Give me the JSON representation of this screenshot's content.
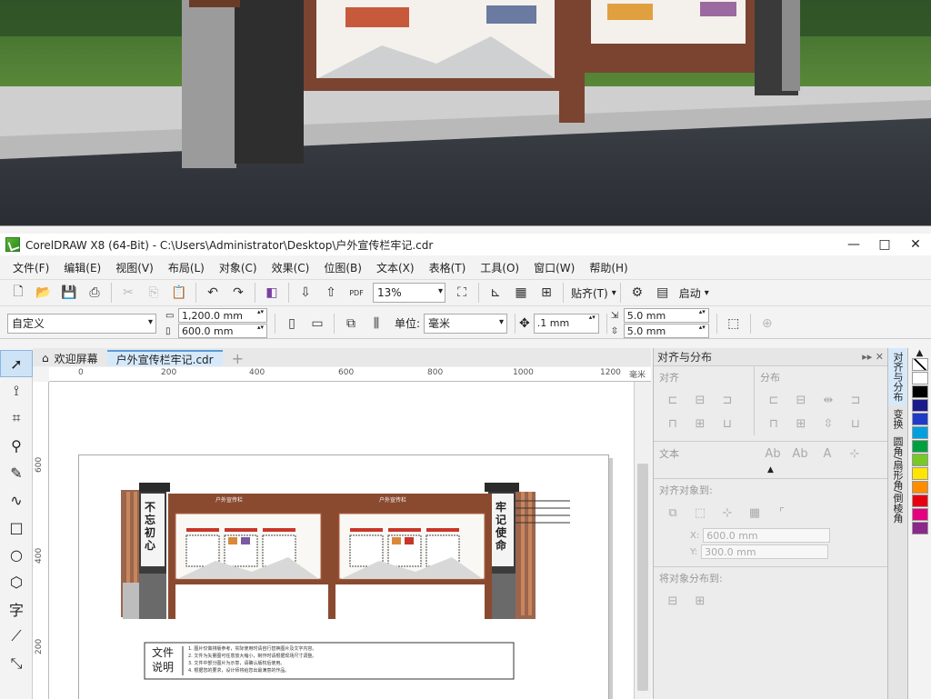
{
  "window": {
    "title": "CorelDRAW X8 (64-Bit) - C:\\Users\\Administrator\\Desktop\\户外宣传栏牢记.cdr",
    "minimize": "—",
    "restore": "□",
    "close": "✕"
  },
  "menu": [
    "文件(F)",
    "编辑(E)",
    "视图(V)",
    "布局(L)",
    "对象(C)",
    "效果(C)",
    "位图(B)",
    "文本(X)",
    "表格(T)",
    "工具(O)",
    "窗口(W)",
    "帮助(H)"
  ],
  "toolbar1": {
    "zoom": "13%",
    "snap_label": "贴齐(T)",
    "launch_label": "启动"
  },
  "toolbar2": {
    "preset": "自定义",
    "width": "1,200.0 mm",
    "height": "600.0 mm",
    "unit_label": "单位:",
    "unit": "毫米",
    "nudge": ".1 mm",
    "dup_x": "5.0 mm",
    "dup_y": "5.0 mm"
  },
  "tabs": [
    {
      "label": "欢迎屏幕"
    },
    {
      "label": "户外宣传栏牢记.cdr"
    }
  ],
  "ruler": {
    "h_ticks": [
      "0",
      "200",
      "400",
      "600",
      "800",
      "1000",
      "1200"
    ],
    "h_unit": "毫米",
    "v_ticks": [
      "600",
      "400",
      "200"
    ]
  },
  "panel": {
    "title": "对齐与分布",
    "align_label": "对齐",
    "distribute_label": "分布",
    "text_label": "文本",
    "align_to_label": "对齐对象到:",
    "x_field": "600.0 mm",
    "y_field": "300.0 mm",
    "distribute_to_label": "将对象分布到:"
  },
  "side_tabs": [
    "对齐与分布",
    "变换",
    "圆角/扇形角/倒棱角"
  ],
  "palette_colors": [
    "#ffffff",
    "#000000",
    "#1a1a8c",
    "#1e3cc8",
    "#00a0e0",
    "#00a040",
    "#78c828",
    "#ffe600",
    "#ff8c00",
    "#e60012",
    "#e4007f",
    "#8c288c"
  ],
  "artwork": {
    "slogan_left": "不忘初心",
    "slogan_right": "牢记使命",
    "board_title": "户外宣传栏",
    "notes_title_1": "文件",
    "notes_title_2": "说明",
    "notes": [
      "1. 图片仅做排版参考，实际使用时请自行替换图片及文字内容。",
      "2. 文件为矢量图可任意放大缩小，制作时请根据现场尺寸调整。",
      "3. 文件中部分图片为示意，请确认版权后使用。",
      "4. 根据您的要求，设计师将给您出最满意的作品。"
    ]
  }
}
